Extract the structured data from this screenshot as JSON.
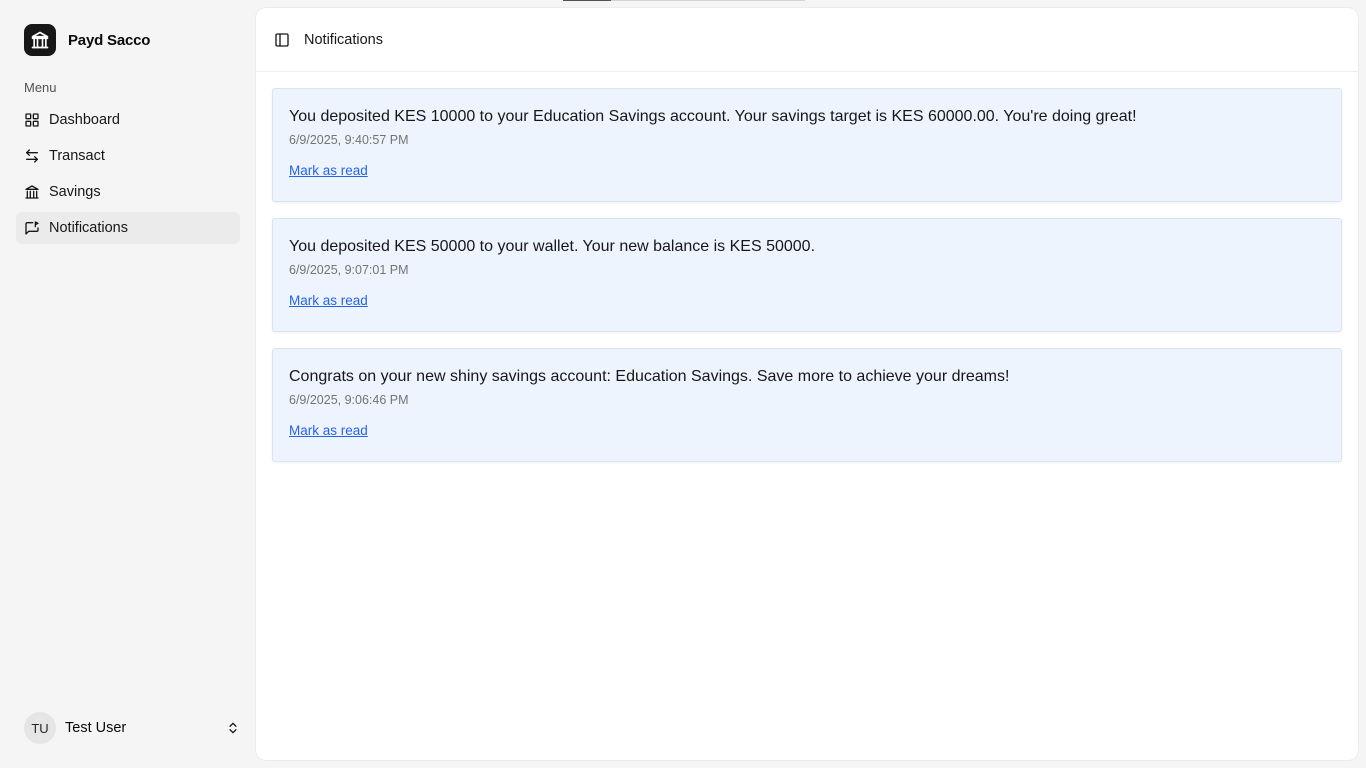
{
  "app": {
    "name": "Payd Sacco",
    "logo_icon": "bank-icon"
  },
  "sidebar": {
    "menu_label": "Menu",
    "items": [
      {
        "label": "Dashboard",
        "icon": "grid-icon",
        "active": false
      },
      {
        "label": "Transact",
        "icon": "arrows-swap-icon",
        "active": false
      },
      {
        "label": "Savings",
        "icon": "bank-icon",
        "active": false
      },
      {
        "label": "Notifications",
        "icon": "message-flag-icon",
        "active": true
      }
    ],
    "user": {
      "initials": "TU",
      "name": "Test User"
    }
  },
  "header": {
    "title": "Notifications",
    "toggle_icon": "sidebar-toggle-icon"
  },
  "notifications": [
    {
      "message": "You deposited KES 10000 to your Education Savings account. Your savings target is KES 60000.00. You're doing great!",
      "timestamp": "6/9/2025, 9:40:57 PM",
      "action": "Mark as read"
    },
    {
      "message": "You deposited KES 50000 to your wallet. Your new balance is KES 50000.",
      "timestamp": "6/9/2025, 9:07:01 PM",
      "action": "Mark as read"
    },
    {
      "message": "Congrats on your new shiny savings account: Education Savings. Save more to achieve your dreams!",
      "timestamp": "6/9/2025, 9:06:46 PM",
      "action": "Mark as read"
    }
  ],
  "colors": {
    "card_background": "#eef4fe",
    "link": "#2563eb",
    "active_nav": "#ebebeb"
  }
}
